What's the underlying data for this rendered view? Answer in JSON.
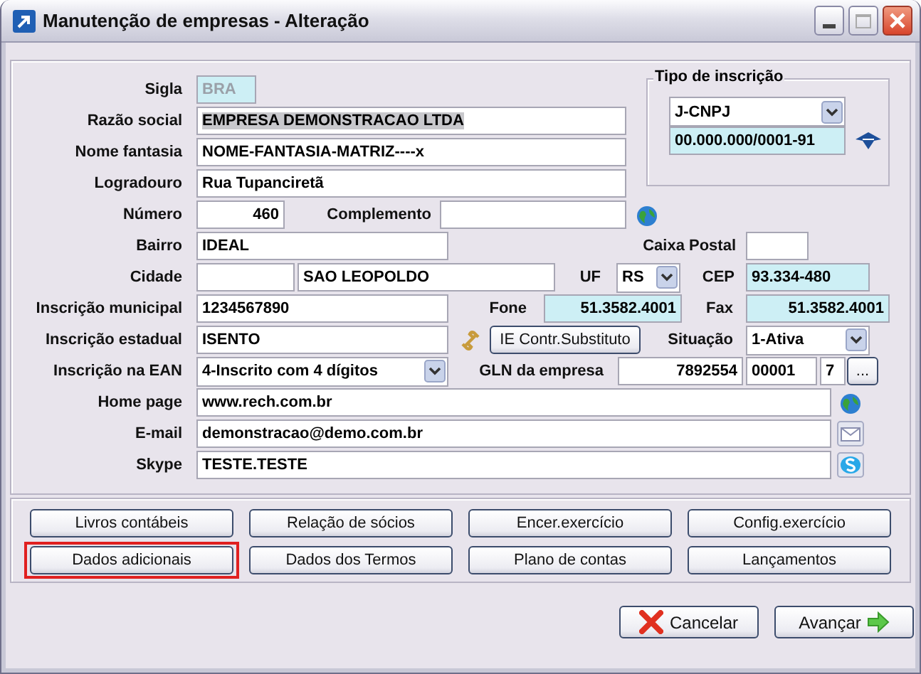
{
  "window": {
    "title": "Manutenção de empresas - Alteração"
  },
  "rows": [
    [
      {
        "kind": "label",
        "text": "Sigla"
      },
      {
        "kind": "input",
        "value": "BRA",
        "readonly": true,
        "disabled": true
      }
    ],
    [
      {
        "kind": "label",
        "text": "Razão social"
      },
      {
        "kind": "input",
        "value": "EMPRESA DEMONSTRACAO LTDA",
        "readonly": false,
        "text_selected": true
      }
    ],
    [
      {
        "kind": "label",
        "text": "Nome fantasia"
      },
      {
        "kind": "input",
        "value": "NOME-FANTASIA-MATRIZ----x",
        "readonly": false
      }
    ],
    [
      {
        "kind": "label",
        "text": "Logradouro"
      },
      {
        "kind": "input",
        "value": "Rua Tupanciretã",
        "readonly": false
      }
    ],
    [
      {
        "kind": "label",
        "text": "Número"
      },
      {
        "kind": "input",
        "value": "460",
        "readonly": false
      },
      {
        "kind": "label",
        "text": "Complemento"
      },
      {
        "kind": "input",
        "readonly": false
      },
      {
        "kind": "globe"
      }
    ],
    [
      {
        "kind": "label",
        "text": "Bairro"
      },
      {
        "kind": "input",
        "value": "IDEAL",
        "readonly": false
      },
      {
        "kind": "label",
        "text": "Caixa Postal"
      },
      {
        "kind": "input",
        "readonly": false
      }
    ],
    [
      {
        "kind": "label",
        "text": "Cidade"
      },
      {
        "kind": "input",
        "readonly": false
      },
      {
        "kind": "input",
        "value": "SAO LEOPOLDO",
        "readonly": false
      },
      {
        "kind": "label",
        "text": "UF"
      },
      {
        "kind": "select",
        "value": "RS"
      },
      {
        "kind": "label",
        "text": "CEP"
      },
      {
        "kind": "input",
        "value": "93.334-480",
        "readonly": true
      }
    ],
    [
      {
        "kind": "label",
        "text": "Inscrição municipal"
      },
      {
        "kind": "input",
        "value": "1234567890",
        "readonly": false
      },
      {
        "kind": "label",
        "text": "Fone"
      },
      {
        "kind": "input",
        "value": "51.3582.4001",
        "readonly": true
      },
      {
        "kind": "label",
        "text": "Fax"
      },
      {
        "kind": "input",
        "value": "51.3582.4001",
        "readonly": true
      }
    ],
    [
      {
        "kind": "label",
        "text": "Inscrição estadual"
      },
      {
        "kind": "input",
        "value": "ISENTO",
        "readonly": false
      },
      {
        "kind": "link"
      },
      {
        "kind": "button",
        "text": "IE Contr.Substituto"
      },
      {
        "kind": "label",
        "text": "Situação"
      },
      {
        "kind": "select",
        "value": "1-Ativa"
      }
    ],
    [
      {
        "kind": "label",
        "text": "Inscrição na EAN"
      },
      {
        "kind": "select",
        "value": "4-Inscrito com 4 dígitos"
      },
      {
        "kind": "label",
        "text": "GLN da empresa"
      },
      {
        "kind": "input",
        "value": "7892554",
        "readonly": false
      },
      {
        "kind": "input",
        "value": "00001",
        "readonly": false
      },
      {
        "kind": "input",
        "value": "7",
        "readonly": false
      },
      {
        "kind": "button",
        "text": "..."
      }
    ],
    [
      {
        "kind": "label",
        "text": "Home page"
      },
      {
        "kind": "input",
        "value": "www.rech.com.br",
        "readonly": false
      },
      {
        "kind": "globe"
      }
    ],
    [
      {
        "kind": "label",
        "text": "E-mail"
      },
      {
        "kind": "input",
        "value": "demonstracao@demo.com.br",
        "readonly": false
      },
      {
        "kind": "mail"
      }
    ],
    [
      {
        "kind": "label",
        "text": "Skype"
      },
      {
        "kind": "input",
        "value": "TESTE.TESTE",
        "readonly": false
      },
      {
        "kind": "cloud"
      }
    ]
  ],
  "registration_type": {
    "title": "Tipo de inscrição",
    "type": "J-CNPJ",
    "number": "00.000.000/0001-91"
  },
  "action_buttons": [
    {
      "label": "Livros contábeis",
      "highlighted": false
    },
    {
      "label": "Relação de sócios",
      "highlighted": false
    },
    {
      "label": "Encer.exercício",
      "highlighted": false
    },
    {
      "label": "Config.exercício",
      "highlighted": false
    },
    {
      "label": "Dados adicionais",
      "highlighted": true
    },
    {
      "label": "Dados dos Termos",
      "highlighted": false
    },
    {
      "label": "Plano de contas",
      "highlighted": false
    },
    {
      "label": "Lançamentos",
      "highlighted": false
    }
  ],
  "footer_buttons": [
    {
      "label": "Cancelar",
      "kind": "cancel"
    },
    {
      "label": "Avançar",
      "kind": "next"
    }
  ]
}
